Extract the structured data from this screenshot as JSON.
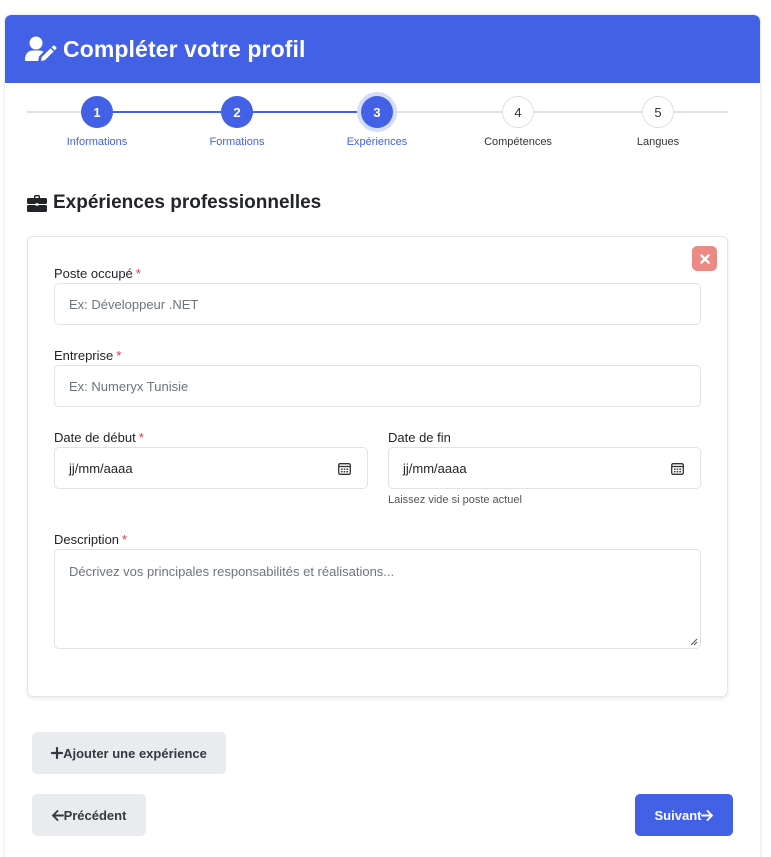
{
  "header": {
    "title": "Compléter votre profil"
  },
  "stepper": {
    "steps": [
      {
        "number": "1",
        "label": "Informations",
        "state": "done"
      },
      {
        "number": "2",
        "label": "Formations",
        "state": "done"
      },
      {
        "number": "3",
        "label": "Expériences",
        "state": "active"
      },
      {
        "number": "4",
        "label": "Compétences",
        "state": "todo"
      },
      {
        "number": "5",
        "label": "Langues",
        "state": "todo"
      }
    ]
  },
  "section": {
    "title": "Expériences professionnelles"
  },
  "experience": {
    "poste": {
      "label": "Poste occupé",
      "required": "*",
      "placeholder": "Ex: Développeur .NET"
    },
    "entreprise": {
      "label": "Entreprise",
      "required": "*",
      "placeholder": "Ex: Numeryx Tunisie"
    },
    "date_debut": {
      "label": "Date de début",
      "required": "*",
      "value": "jj/mm/aaaa"
    },
    "date_fin": {
      "label": "Date de fin",
      "value": "jj/mm/aaaa",
      "help": "Laissez vide si poste actuel"
    },
    "description": {
      "label": "Description",
      "required": "*",
      "placeholder": "Décrivez vos principales responsabilités et réalisations..."
    }
  },
  "actions": {
    "add_label": "Ajouter une expérience",
    "prev_label": "Précédent",
    "next_label": "Suivant"
  },
  "colors": {
    "primary": "#4361e6",
    "remove": "#ea8a83",
    "required": "#dc3545"
  },
  "icons": {
    "header": "user-edit-icon",
    "section": "briefcase-icon",
    "remove": "close-icon",
    "calendar": "calendar-icon",
    "add": "plus-icon",
    "prev": "arrow-left-icon",
    "next": "arrow-right-icon"
  }
}
